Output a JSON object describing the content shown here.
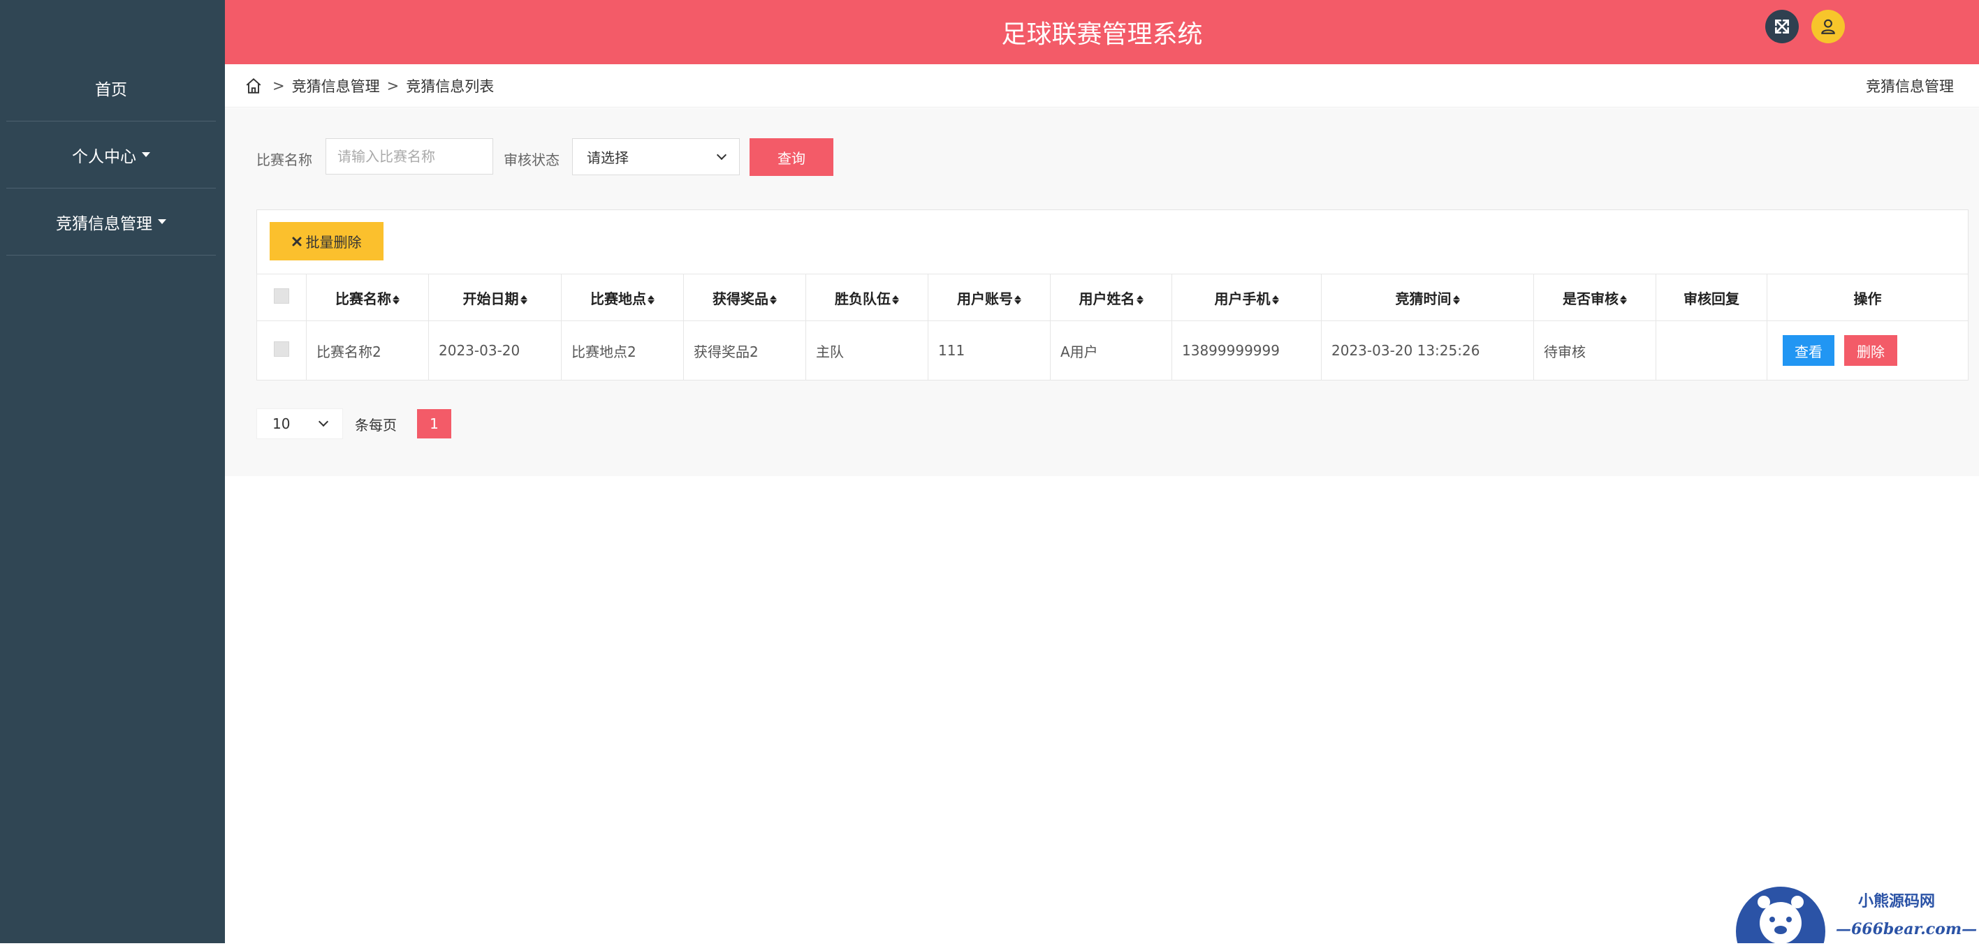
{
  "app": {
    "title": "足球联赛管理系统"
  },
  "sidebar": {
    "items": [
      {
        "label": "首页"
      },
      {
        "label": "个人中心"
      },
      {
        "label": "竞猜信息管理"
      }
    ]
  },
  "breadcrumb": {
    "sep": ">",
    "items": [
      "竞猜信息管理",
      "竞猜信息列表"
    ],
    "right": "竞猜信息管理"
  },
  "filters": {
    "name_label": "比赛名称",
    "name_placeholder": "请输入比赛名称",
    "name_value": "",
    "status_label": "审核状态",
    "status_value": "请选择",
    "query_label": "查询"
  },
  "toolbar": {
    "batch_delete_label": "批量删除"
  },
  "table": {
    "columns": [
      "比赛名称",
      "开始日期",
      "比赛地点",
      "获得奖品",
      "胜负队伍",
      "用户账号",
      "用户姓名",
      "用户手机",
      "竞猜时间",
      "是否审核",
      "审核回复",
      "操作"
    ],
    "rows": [
      {
        "match_name": "比赛名称2",
        "start_date": "2023-03-20",
        "location": "比赛地点2",
        "prize": "获得奖品2",
        "team": "主队",
        "account": "111",
        "user_name": "A用户",
        "phone": "13899999999",
        "guess_time": "2023-03-20 13:25:26",
        "review_status": "待审核",
        "review_reply": "",
        "view_label": "查看",
        "delete_label": "删除"
      }
    ]
  },
  "pagination": {
    "page_size": "10",
    "per_page_label": "条每页",
    "current_page": "1"
  },
  "watermark": {
    "line1": "小熊源码网",
    "line2": "—666bear.com—"
  },
  "colors": {
    "sidebar": "#304654",
    "accent": "#f35b68",
    "warning": "#fbc02d",
    "info": "#2196f3"
  }
}
